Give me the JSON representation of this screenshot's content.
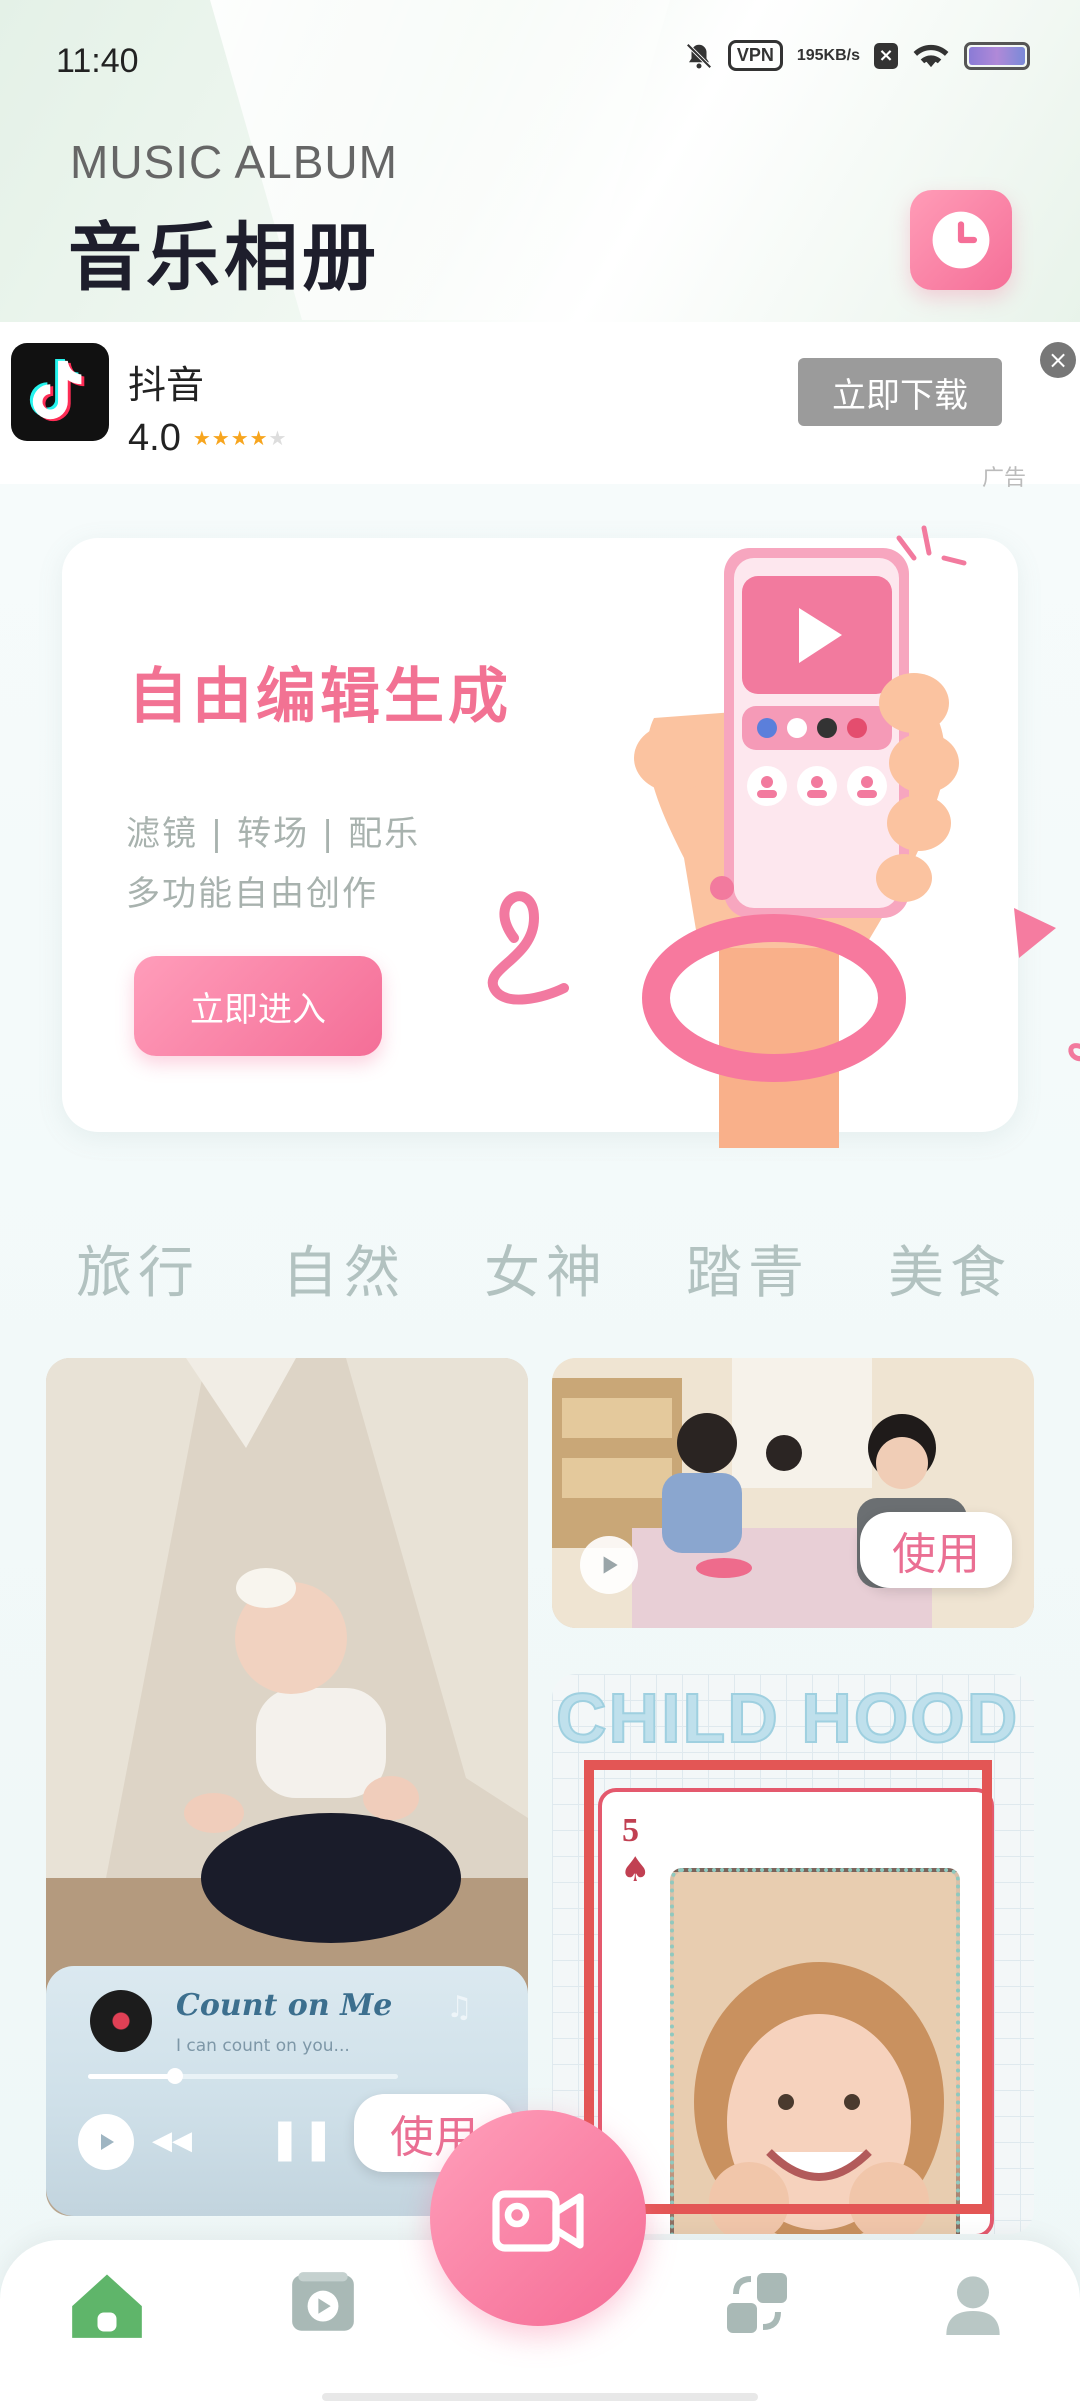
{
  "status_bar": {
    "time": "11:40",
    "vpn": "VPN",
    "net_speed_value": "195",
    "net_speed_unit": "KB/s",
    "sim_icon": "x-box-icon",
    "battery_color": "#9b86d8"
  },
  "header": {
    "subtitle": "MUSIC ALBUM",
    "title": "音乐相册",
    "history_icon": "clock-icon"
  },
  "ad": {
    "app_name": "抖音",
    "rating": "4.0",
    "stars_filled": 4,
    "stars_total": 5,
    "download_label": "立即下载",
    "close_label": "×",
    "ad_label": "广告"
  },
  "hero": {
    "title": "自由编辑生成",
    "desc_line1": "滤镜 | 转场 | 配乐",
    "desc_line2": "多功能自由创作",
    "button_label": "立即进入"
  },
  "categories": [
    "旅行",
    "自然",
    "女神",
    "踏青",
    "美食"
  ],
  "cards": {
    "card_a": {
      "song_title": "Count on Me",
      "song_subtitle": "I can count on you...",
      "progress": 0.28,
      "use_label": "使用"
    },
    "card_b": {
      "use_label": "使用"
    },
    "card_c": {
      "heading": "CHILD HOOD",
      "card_number": "5",
      "card_suit": "♠"
    }
  },
  "colors": {
    "accent_pink": "#f46e97",
    "category_text": "#b2c2c0",
    "highlight_red": "#e35655"
  },
  "bottom_nav": {
    "items": [
      "home-icon",
      "album-icon",
      "record-video-icon",
      "swap-icon",
      "profile-icon"
    ]
  }
}
